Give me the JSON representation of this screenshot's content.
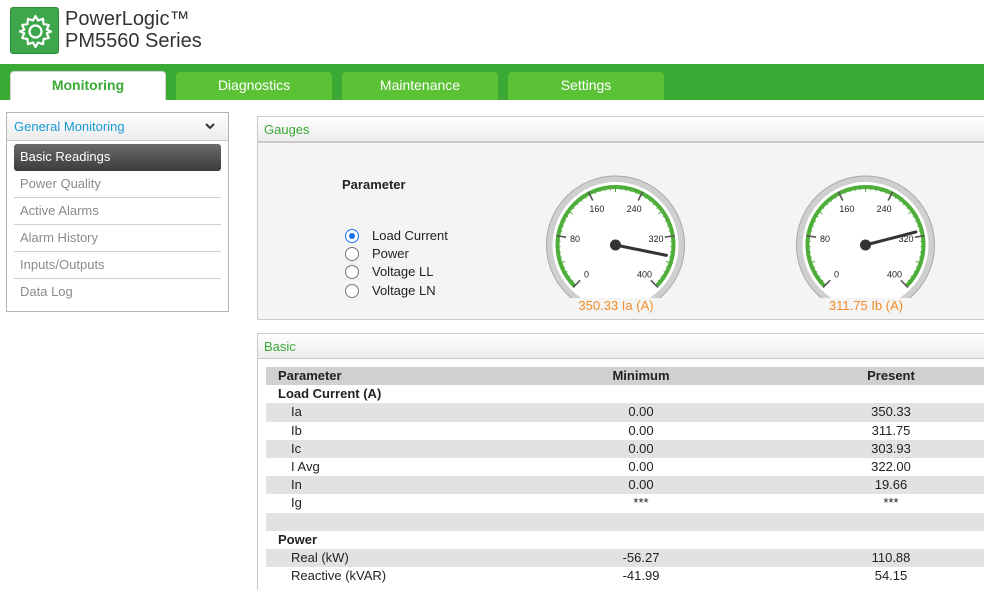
{
  "app": {
    "title_line1": "PowerLogic™",
    "title_line2": "PM5560 Series",
    "logo_icon": "gear-icon"
  },
  "colors": {
    "brand_green": "#3aaa35",
    "tab_green": "#5bc236",
    "link_blue": "#1b9ad6",
    "gauge_label": "#f28c28"
  },
  "tabs": [
    {
      "label": "Monitoring",
      "active": true
    },
    {
      "label": "Diagnostics",
      "active": false
    },
    {
      "label": "Maintenance",
      "active": false
    },
    {
      "label": "Settings",
      "active": false
    }
  ],
  "sidebar": {
    "section": "General Monitoring",
    "items": [
      {
        "label": "Basic Readings",
        "active": true
      },
      {
        "label": "Power Quality"
      },
      {
        "label": "Active Alarms"
      },
      {
        "label": "Alarm History"
      },
      {
        "label": "Inputs/Outputs"
      },
      {
        "label": "Data Log"
      }
    ]
  },
  "gauges": {
    "title": "Gauges",
    "parameter_title": "Parameter",
    "options": [
      {
        "label": "Load Current",
        "selected": true
      },
      {
        "label": "Power",
        "selected": false
      },
      {
        "label": "Voltage LL",
        "selected": false
      },
      {
        "label": "Voltage LN",
        "selected": false
      }
    ],
    "dials": [
      {
        "value": 350.33,
        "label": "350.33 Ia (A)",
        "ticks": [
          "0",
          "80",
          "160",
          "240",
          "320",
          "400"
        ],
        "max": 400
      },
      {
        "value": 311.75,
        "label": "311.75 Ib (A)",
        "ticks": [
          "0",
          "80",
          "160",
          "240",
          "320",
          "400"
        ],
        "max": 400
      }
    ]
  },
  "basic": {
    "title": "Basic",
    "columns": {
      "parameter": "Parameter",
      "minimum": "Minimum",
      "present": "Present"
    },
    "groups": [
      {
        "name": "Load Current (A)",
        "rows": [
          {
            "name": "Ia",
            "min": "0.00",
            "present": "350.33"
          },
          {
            "name": "Ib",
            "min": "0.00",
            "present": "311.75"
          },
          {
            "name": "Ic",
            "min": "0.00",
            "present": "303.93"
          },
          {
            "name": "I Avg",
            "min": "0.00",
            "present": "322.00"
          },
          {
            "name": "In",
            "min": "0.00",
            "present": "19.66"
          },
          {
            "name": "Ig",
            "min": "***",
            "present": "***"
          }
        ]
      },
      {
        "name": "Power",
        "rows": [
          {
            "name": "Real (kW)",
            "min": "-56.27",
            "present": "110.88"
          },
          {
            "name": "Reactive (kVAR)",
            "min": "-41.99",
            "present": "54.15"
          }
        ]
      }
    ]
  }
}
